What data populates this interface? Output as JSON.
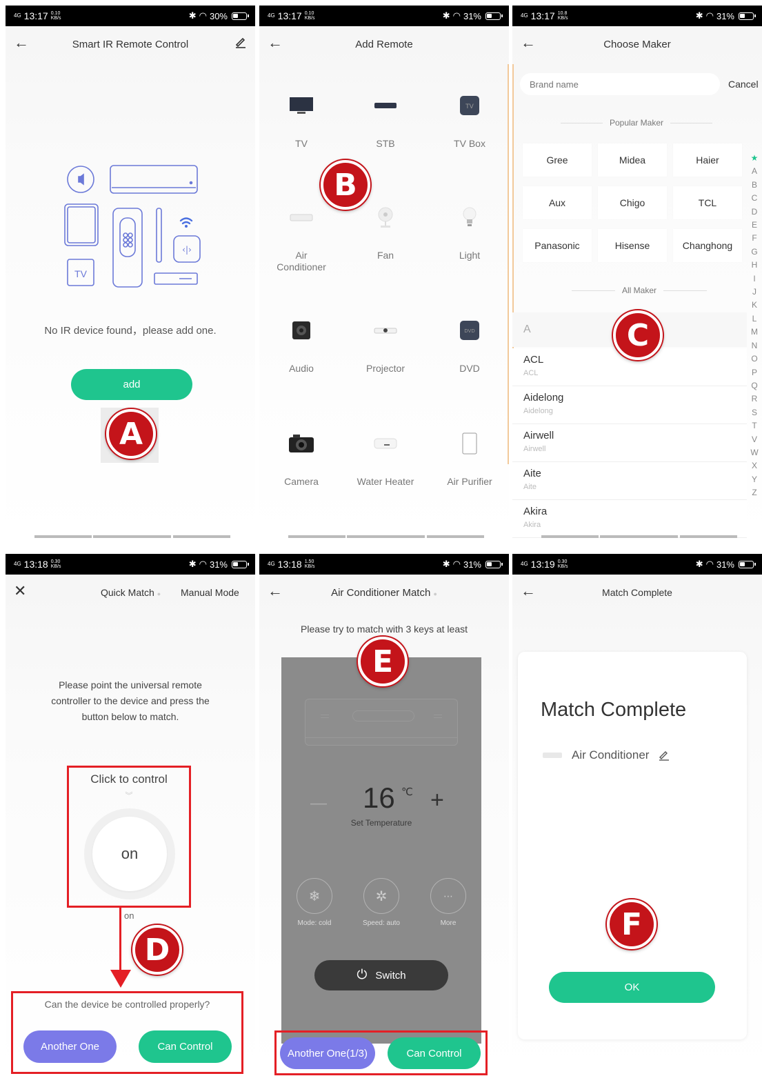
{
  "status_bars": [
    {
      "time": "13:17",
      "speed": "0.10",
      "battery": "30%"
    },
    {
      "time": "13:17",
      "speed": "0.10",
      "battery": "31%"
    },
    {
      "time": "13:17",
      "speed": "10.8",
      "battery": "31%"
    },
    {
      "time": "13:18",
      "speed": "0.30",
      "battery": "31%"
    },
    {
      "time": "13:18",
      "speed": "1.50",
      "battery": "31%"
    },
    {
      "time": "13:19",
      "speed": "0.30",
      "battery": "31%"
    }
  ],
  "network_label": "4G",
  "speed_unit": "KB/s",
  "panelA": {
    "title": "Smart IR Remote Control",
    "empty_text": "No IR device found，please add one.",
    "add_label": "add",
    "badge": "A",
    "illus_tv": "TV"
  },
  "panelB": {
    "title": "Add Remote",
    "badge": "B",
    "categories": [
      {
        "label": "TV",
        "icon": "tv-icon"
      },
      {
        "label": "STB",
        "icon": "stb-icon"
      },
      {
        "label": "TV Box",
        "icon": "tv-box-icon",
        "icon_text": "TV"
      },
      {
        "label": "Air Conditioner",
        "icon": "air-conditioner-icon"
      },
      {
        "label": "Fan",
        "icon": "fan-icon"
      },
      {
        "label": "Light",
        "icon": "light-bulb-icon"
      },
      {
        "label": "Audio",
        "icon": "speaker-icon"
      },
      {
        "label": "Projector",
        "icon": "projector-icon"
      },
      {
        "label": "DVD",
        "icon": "dvd-icon",
        "icon_text": "DVD"
      },
      {
        "label": "Camera",
        "icon": "camera-icon"
      },
      {
        "label": "Water Heater",
        "icon": "water-heater-icon"
      },
      {
        "label": "Air Purifier",
        "icon": "air-purifier-icon"
      }
    ]
  },
  "panelC": {
    "title": "Choose Maker",
    "search_placeholder": "Brand name",
    "cancel": "Cancel",
    "popular_label": "Popular Maker",
    "all_label": "All Maker",
    "badge": "C",
    "popular": [
      "Gree",
      "Midea",
      "Haier",
      "Aux",
      "Chigo",
      "TCL",
      "Panasonic",
      "Hisense",
      "Changhong"
    ],
    "section": "A",
    "brands": [
      {
        "name": "ACL",
        "sub": "ACL"
      },
      {
        "name": "Aidelong",
        "sub": "Aidelong"
      },
      {
        "name": "Airwell",
        "sub": "Airwell"
      },
      {
        "name": "Aite",
        "sub": "Aite"
      },
      {
        "name": "Akira",
        "sub": "Akira"
      }
    ],
    "alphabet": [
      "★",
      "A",
      "B",
      "C",
      "D",
      "E",
      "F",
      "G",
      "H",
      "I",
      "J",
      "K",
      "L",
      "M",
      "N",
      "O",
      "P",
      "Q",
      "R",
      "S",
      "T",
      "V",
      "W",
      "X",
      "Y",
      "Z"
    ]
  },
  "panelD": {
    "tab_quick": "Quick Match",
    "tab_manual": "Manual Mode",
    "instruction": "Please point the universal remote controller to the device and press the button below to match.",
    "click_label": "Click to control",
    "on_label": "on",
    "on_small": "on",
    "question": "Can the device be controlled properly?",
    "another": "Another One",
    "can": "Can Control",
    "badge": "D"
  },
  "panelE": {
    "title": "Air Conditioner Match",
    "hint": "Please try to match with 3 keys at least",
    "temp": "16",
    "unit": "℃",
    "minus": "—",
    "plus": "+",
    "set_label": "Set Temperature",
    "mode": "Mode: cold",
    "speed": "Speed: auto",
    "more": "More",
    "switch": "Switch",
    "another": "Another One(1/3)",
    "can": "Can Control",
    "badge": "E"
  },
  "panelF": {
    "title": "Match Complete",
    "heading": "Match Complete",
    "device": "Air Conditioner",
    "ok": "OK",
    "badge": "F"
  },
  "colors": {
    "green": "#1fc58e",
    "purple": "#7b7ae8",
    "badge_red": "#c4141a",
    "box_red": "#e41f25"
  }
}
